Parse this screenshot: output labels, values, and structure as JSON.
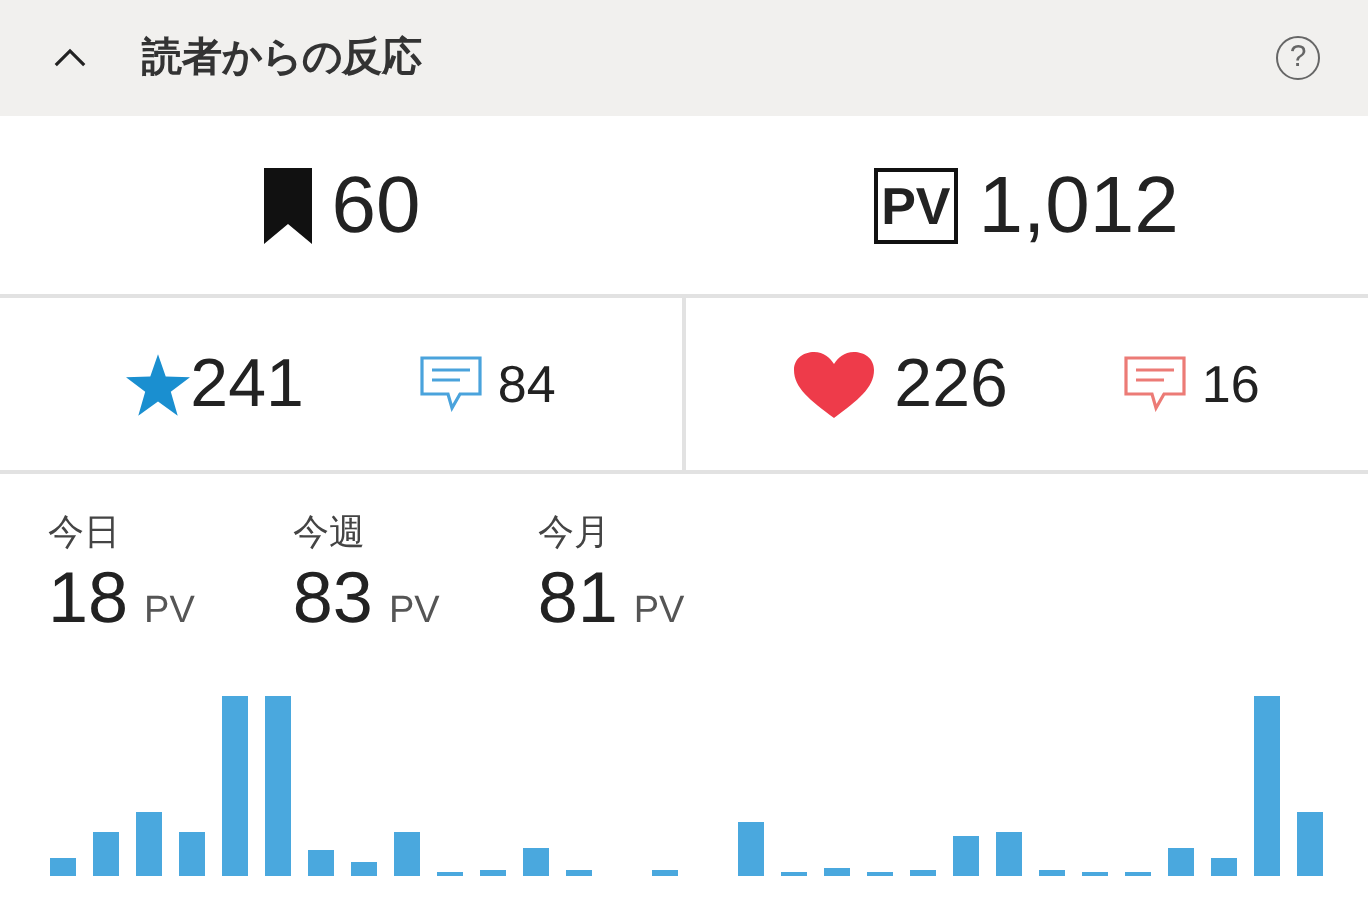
{
  "header": {
    "title": "読者からの反応",
    "expanded": true,
    "help": "?"
  },
  "totals": [
    {
      "kind": "bookmark",
      "value": "60"
    },
    {
      "kind": "pageviews",
      "badge": "PV",
      "value": "1,012"
    }
  ],
  "reactions": [
    {
      "kind": "star",
      "value": "241",
      "comments": "84"
    },
    {
      "kind": "heart",
      "value": "226",
      "comments": "16"
    }
  ],
  "stats": [
    {
      "label": "今日",
      "value": "18",
      "unit": "PV"
    },
    {
      "label": "今週",
      "value": "83",
      "unit": "PV"
    },
    {
      "label": "今月",
      "value": "81",
      "unit": "PV"
    }
  ]
}
